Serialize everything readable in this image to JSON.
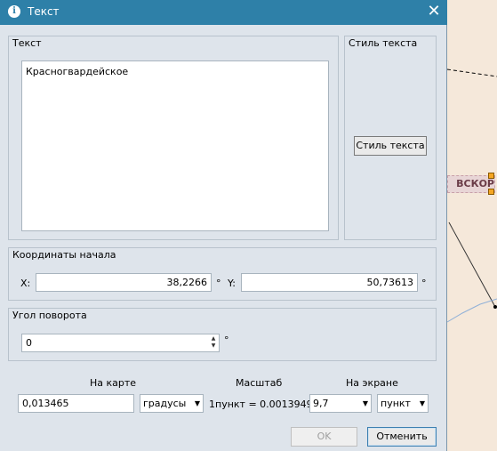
{
  "window": {
    "title": "Текст",
    "close_glyph": "✕"
  },
  "text_group": {
    "title": "Текст",
    "content": "Красногвардейское"
  },
  "style_group": {
    "title": "Стиль текста",
    "button_label": "Стиль текста"
  },
  "coords_group": {
    "title": "Координаты начала",
    "x_label": "X:",
    "x_value": "38,2266",
    "x_unit": "°",
    "y_label": "Y:",
    "y_value": "50,73613",
    "y_unit": "°"
  },
  "rotation_group": {
    "title": "Угол поворота",
    "value": "0",
    "unit": "°"
  },
  "scale": {
    "map_header": "На карте",
    "map_value": "0,013465",
    "map_unit": "градусы",
    "scale_header": "Масштаб",
    "scale_text": "1пункт = 0.0013949°",
    "screen_header": "На экране",
    "screen_value": "9,7",
    "screen_unit": "пункт"
  },
  "buttons": {
    "ok": "OK",
    "cancel": "Отменить"
  },
  "map": {
    "label": "ВСКОР"
  },
  "colors": {
    "titlebar": "#2e80a8",
    "dialog_bg": "#dee4eb",
    "map_bg": "#f5e8da"
  }
}
